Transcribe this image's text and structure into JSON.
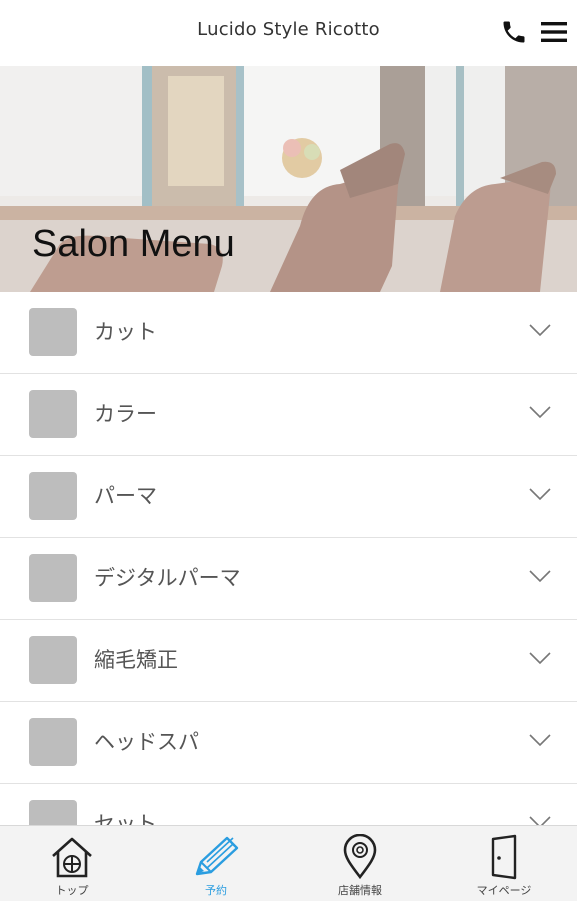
{
  "header": {
    "title": "Lucido Style Ricotto",
    "phone_icon": "phone-icon",
    "menu_icon": "hamburger-menu-icon"
  },
  "hero": {
    "title": "Salon Menu"
  },
  "menu": {
    "items": [
      {
        "label": "カット"
      },
      {
        "label": "カラー"
      },
      {
        "label": "パーマ"
      },
      {
        "label": "デジタルパーマ"
      },
      {
        "label": "縮毛矯正"
      },
      {
        "label": "ヘッドスパ"
      },
      {
        "label": "セット"
      }
    ]
  },
  "nav": {
    "items": [
      {
        "label": "トップ",
        "icon": "home-icon"
      },
      {
        "label": "予約",
        "icon": "pencil-icon",
        "active": true
      },
      {
        "label": "店舗情報",
        "icon": "map-pin-icon"
      },
      {
        "label": "マイページ",
        "icon": "door-icon"
      }
    ]
  },
  "colors": {
    "accent": "#2a9de0",
    "thumb": "#bdbdbd",
    "nav_bg": "#f3f3f3"
  }
}
